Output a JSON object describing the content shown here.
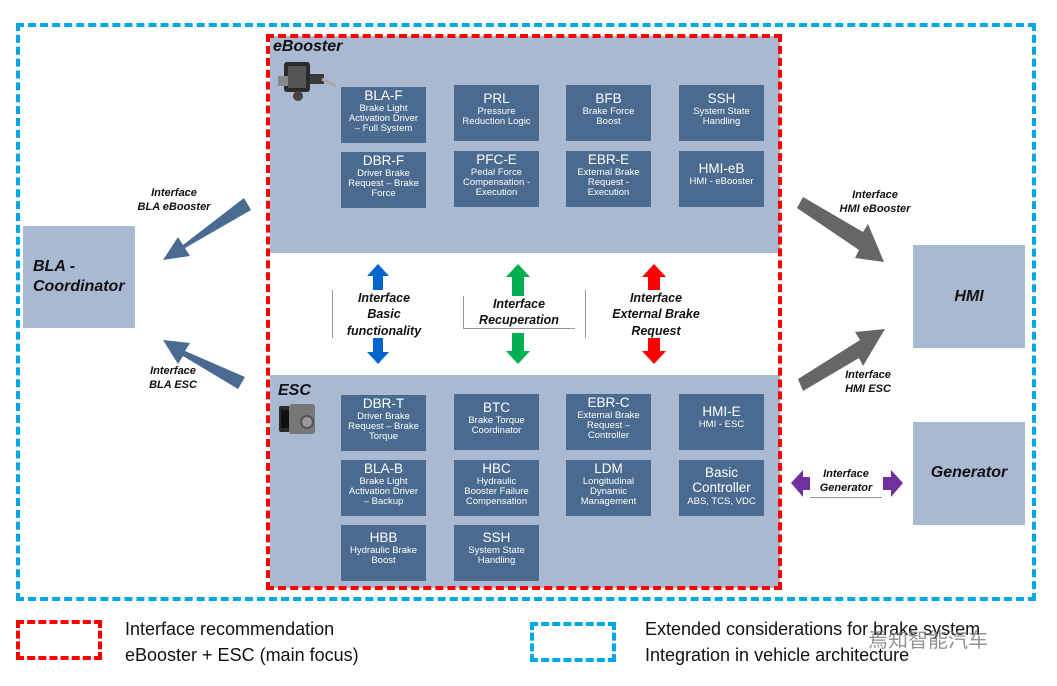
{
  "colors": {
    "panel": "#a8b9d1",
    "function_box": "#4a6a90",
    "focus_border": "#ff0000",
    "extended_border": "#00a8e8",
    "arrow_blue": "#0066cc",
    "arrow_green": "#00b050",
    "arrow_red": "#ff0000",
    "arrow_purple": "#7030a0",
    "arrow_slate": "#4a6a90",
    "arrow_gray": "#666666"
  },
  "eBooster": {
    "title": "eBooster",
    "device_icon": "ebooster-unit-image",
    "functions": [
      {
        "abbr": "BLA-F",
        "desc": "Brake Light\nActivation Driver\n– Full System"
      },
      {
        "abbr": "PRL",
        "desc": "Pressure\nReduction Logic"
      },
      {
        "abbr": "BFB",
        "desc": "Brake Force\nBoost"
      },
      {
        "abbr": "SSH",
        "desc": "System State\nHandling"
      },
      {
        "abbr": "DBR-F",
        "desc": "Driver Brake\nRequest – Brake\nForce"
      },
      {
        "abbr": "PFC-E",
        "desc": "Pedal Force\nCompensation -\nExecution"
      },
      {
        "abbr": "EBR-E",
        "desc": "External Brake\nRequest -\nExecution"
      },
      {
        "abbr": "HMI-eB",
        "desc": "HMI - eBooster"
      }
    ]
  },
  "esc": {
    "title": "ESC",
    "device_icon": "esc-unit-image",
    "functions": [
      {
        "abbr": "DBR-T",
        "desc": "Driver Brake\nRequest – Brake\nTorque"
      },
      {
        "abbr": "BTC",
        "desc": "Brake Torque\nCoordinator"
      },
      {
        "abbr": "EBR-C",
        "desc": "External Brake\nRequest –\nController"
      },
      {
        "abbr": "HMI-E",
        "desc": "HMI - ESC"
      },
      {
        "abbr": "BLA-B",
        "desc": "Brake Light\nActivation Driver\n– Backup"
      },
      {
        "abbr": "HBC",
        "desc": "Hydraulic\nBooster Failure\nCompensation"
      },
      {
        "abbr": "LDM",
        "desc": "Longitudinal\nDynamic\nManagement"
      },
      {
        "abbr": "Basic\nController",
        "desc": "ABS, TCS, VDC"
      },
      {
        "abbr": "HBB",
        "desc": "Hydraulic Brake\nBoost"
      },
      {
        "abbr": "SSH",
        "desc": "System State\nHandling"
      }
    ]
  },
  "interfaces": {
    "basic": "Interface\nBasic\nfunctionality",
    "recuperation": "Interface\nRecuperation",
    "external_brake": "Interface\nExternal Brake\nRequest",
    "bla_ebooster": "Interface\nBLA eBooster",
    "bla_esc": "Interface\nBLA ESC",
    "hmi_ebooster": "Interface\nHMI eBooster",
    "hmi_esc": "Interface\nHMI ESC",
    "generator": "Interface\nGenerator"
  },
  "external_components": {
    "bla_coordinator": "BLA -\nCoordinator",
    "hmi": "HMI",
    "generator": "Generator"
  },
  "legend": {
    "focus": "Interface recommendation\neBooster + ESC (main focus)",
    "extended": "Extended considerations for brake system\nIntegration in vehicle architecture"
  },
  "watermark": "焉知智能汽车"
}
